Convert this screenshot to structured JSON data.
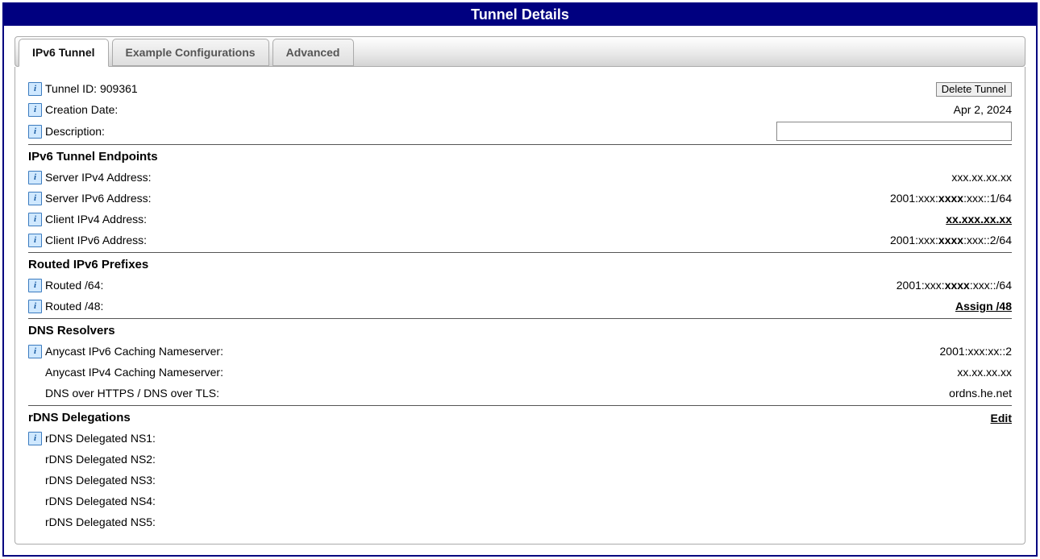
{
  "panel_title": "Tunnel Details",
  "tabs": {
    "ipv6": "IPv6 Tunnel",
    "example": "Example Configurations",
    "advanced": "Advanced"
  },
  "delete_btn": "Delete Tunnel",
  "general": {
    "tunnel_id_label": "Tunnel ID: 909361",
    "creation_date_label": "Creation Date:",
    "creation_date_value": "Apr 2, 2024",
    "description_label": "Description:",
    "description_value": ""
  },
  "endpoints": {
    "title": "IPv6 Tunnel Endpoints",
    "server_v4_label": "Server IPv4 Address:",
    "server_v4_value": "xxx.xx.xx.xx",
    "server_v6_label": "Server IPv6 Address:",
    "server_v6": {
      "pre": "2001:xxx:",
      "bold": "xxxx",
      "post": ":xxx::1/64"
    },
    "client_v4_label": "Client IPv4 Address:",
    "client_v4_value": "xx.xxx.xx.xx",
    "client_v6_label": "Client IPv6 Address:",
    "client_v6": {
      "pre": "2001:xxx:",
      "bold": "xxxx",
      "post": ":xxx::2/64"
    }
  },
  "routed": {
    "title": "Routed IPv6 Prefixes",
    "r64_label": "Routed /64:",
    "r64": {
      "pre": "2001:xxx:",
      "bold": "xxxx",
      "post": ":xxx::/64"
    },
    "r48_label": "Routed /48:",
    "assign48": "Assign /48"
  },
  "dns": {
    "title": "DNS Resolvers",
    "anycast_v6_label": "Anycast IPv6 Caching Nameserver:",
    "anycast_v6_value": "2001:xxx:xx::2",
    "anycast_v4_label": "Anycast IPv4 Caching Nameserver:",
    "anycast_v4_value": "xx.xx.xx.xx",
    "doh_label": "DNS over HTTPS / DNS over TLS:",
    "doh_value": "ordns.he.net"
  },
  "rdns": {
    "title": "rDNS Delegations",
    "edit": "Edit",
    "ns1": "rDNS Delegated NS1:",
    "ns2": "rDNS Delegated NS2:",
    "ns3": "rDNS Delegated NS3:",
    "ns4": "rDNS Delegated NS4:",
    "ns5": "rDNS Delegated NS5:"
  }
}
